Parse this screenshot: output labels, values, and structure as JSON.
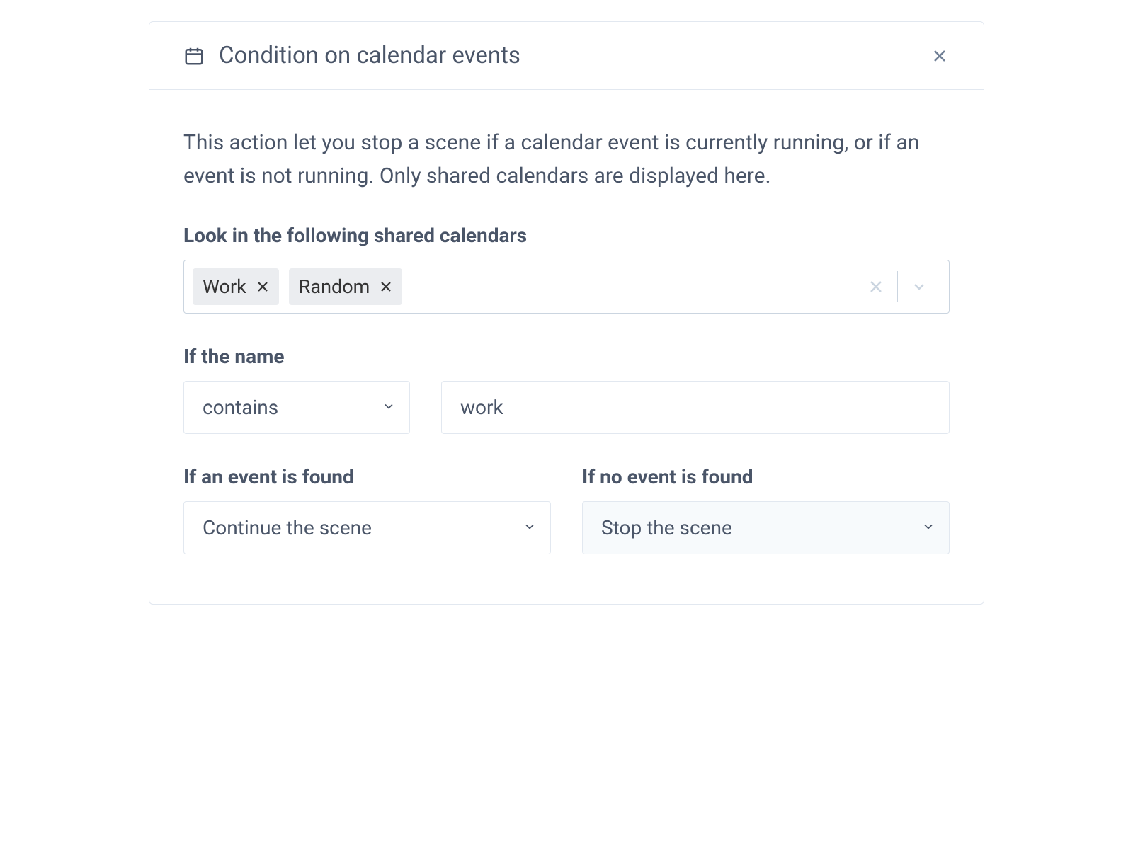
{
  "header": {
    "title": "Condition on calendar events"
  },
  "description": "This action let you stop a scene if a calendar event is currently running, or if an event is not running. Only shared calendars are displayed here.",
  "calendars": {
    "label": "Look in the following shared calendars",
    "selected": [
      "Work",
      "Random"
    ]
  },
  "name_filter": {
    "label": "If the name",
    "operator": "contains",
    "value": "work"
  },
  "event_found": {
    "label": "If an event is found",
    "value": "Continue the scene"
  },
  "event_not_found": {
    "label": "If no event is found",
    "value": "Stop the scene"
  }
}
